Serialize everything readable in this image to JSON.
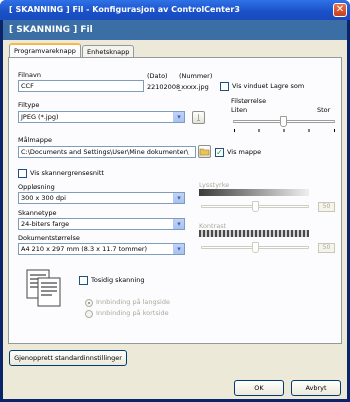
{
  "window": {
    "title": "[ SKANNING ]   Fil - Konfigurasjon av ControlCenter3",
    "close_glyph": "✕"
  },
  "banner": {
    "text": "[ SKANNING ]   Fil"
  },
  "tabs": [
    {
      "label": "Programvareknapp"
    },
    {
      "label": "Enhetsknapp"
    }
  ],
  "filename": {
    "label": "Filnavn",
    "value": "CCF",
    "date_label": "(Dato)",
    "date_value": "22102008",
    "number_label": "(Nummer)",
    "number_value": "_xxxx.jpg",
    "show_save_as_label": "Vis vinduet Lagre som",
    "show_save_as_checked": false
  },
  "filetype": {
    "label": "Filtype",
    "value": "JPEG (*.jpg)"
  },
  "filesize": {
    "label": "Filstørrelse",
    "min_label": "Liten",
    "max_label": "Stor"
  },
  "destination": {
    "label": "Målmappe",
    "value": "C:\\Documents and Settings\\User\\Mine dokumenter\\",
    "show_folder_label": "Vis mappe",
    "show_folder_checked": true,
    "check_glyph": "✓"
  },
  "scanner_interface": {
    "label": "Vis skannergrensesnitt",
    "checked": false
  },
  "resolution": {
    "label": "Oppløsning",
    "value": "300 x 300 dpi"
  },
  "scan_type": {
    "label": "Skannetype",
    "value": "24-biters farge"
  },
  "doc_size": {
    "label": "Dokumentstørrelse",
    "value": "A4 210 x 297 mm (8.3 x 11.7 tommer)"
  },
  "brightness": {
    "label": "Lysstyrke",
    "value": "50"
  },
  "contrast": {
    "label": "Kontrast",
    "value": "50"
  },
  "duplex": {
    "label": "Tosidig skanning",
    "checked": false,
    "option_long": "Innbinding på langside",
    "option_short": "Innbinding på kortside"
  },
  "buttons": {
    "restore_defaults": "Gjenopprett standardinnstillinger",
    "ok": "OK",
    "cancel": "Avbryt"
  },
  "dropdown_arrow": "▾"
}
